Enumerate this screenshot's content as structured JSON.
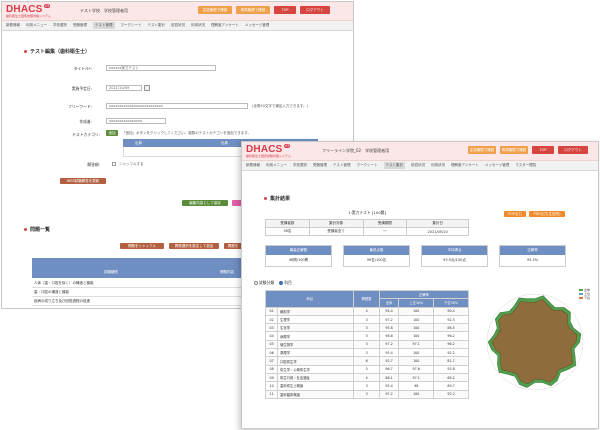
{
  "app": {
    "logo": "DHACS",
    "logo_badge": "V3",
    "logo_tagline": "歯科衛生士国家試験対策システム"
  },
  "colors": {
    "accent": "#d93a4a",
    "header_bg": "#fbe7e7",
    "table_head": "#6f8ec2"
  },
  "back": {
    "school": "テスト学校　学校管理者用",
    "header_buttons": [
      "生徒権限で確認",
      "教員権限で確認",
      "TOP",
      "ログアウト"
    ],
    "nav": [
      "新着情報",
      "利用メニュー",
      "学校選択",
      "受験管理",
      "テスト管理",
      "マークシート",
      "テスト集計",
      "前週状況",
      "利用状況",
      "理解度アンケート",
      "メッセージ管理",
      "マスター閲覧"
    ],
    "nav_active": 4,
    "section_title": "テスト編集（歯科衛生士）",
    "form": {
      "title_label": "タイトル*:",
      "title_value": "xxxxxx実力テスト",
      "date_label": "実施予定日:",
      "date_value": "2021/10/09",
      "freeword_label": "フリーワード:",
      "freeword_value": "xxxxxxxxxxxxxxxxxxxxxxxxxx",
      "freeword_note": "(全角50文字で補足入力できます。)",
      "author_label": "作成者:",
      "author_value": "xxxxxxxxxxxxxxxx",
      "category_label": "テストカテゴリ:",
      "category_add": "追加",
      "category_note": "「追加」ボタンをクリックしてください。複数のテストカテゴリを追加できます。",
      "cat_col1": "出典",
      "cat_col2": "出典",
      "shuffle_label": "解答順:",
      "shuffle_option": "シャッフルする",
      "convert_button": "WEB試験解答を更新",
      "save_button": "編集内容として保存",
      "pink_button": ""
    },
    "q_list_title": "問題一覧",
    "q_buttons": [
      "問題をシャッフル",
      "問題選択を推定して追加",
      "問題を"
    ],
    "q_head_col1": "試験種別",
    "q_head_col2": "問題内容",
    "q_rows": [
      "人体（歯・口腔を除く）の構造と機能",
      "歯・口腔の構造と機能",
      "疾病の成り立ち及び回復過程の促進"
    ]
  },
  "front": {
    "school": "フリーライン学院_02　学校管理者用",
    "header_buttons": [
      "生徒権限で確認",
      "教員権限で確認",
      "TOP",
      "ログアウト"
    ],
    "nav": [
      "新着情報",
      "利用メニュー",
      "学校選択",
      "受験管理",
      "テスト管理",
      "マークシート",
      "テスト集計",
      "前週状況",
      "利用状況",
      "理解度アンケート",
      "メッセージ管理",
      "マスター閲覧"
    ],
    "nav_active": 6,
    "section_title": "集計結果",
    "test_name": "1:実力テスト [100題]",
    "info_headers": [
      "受講者数",
      "集計対象",
      "受講期間",
      "集計日"
    ],
    "info_values": [
      "36名",
      "受講者全て",
      "〜",
      "2021/05/10"
    ],
    "pdf_buttons": [
      "PDF出力",
      "PDF出力(生徒別)"
    ],
    "stats": [
      {
        "label": "最高正解数",
        "value": "98問/100問"
      },
      {
        "label": "最低点数",
        "value": "99名/100名"
      },
      {
        "label": "平均得点",
        "value": "93.5点/100点"
      },
      {
        "label": "正解率",
        "value": "93.5%"
      }
    ],
    "mode_options": [
      "試験分類",
      "科目"
    ],
    "result_headers": [
      "科目",
      "問題数",
      "全体",
      "上位30%",
      "下位30%"
    ],
    "result_group_header": "正解率",
    "result_rows": [
      [
        "01",
        "解剖学",
        "4",
        "94.4",
        "100",
        "90.4"
      ],
      [
        "02",
        "生理学",
        "3",
        "97.2",
        "100",
        "92.5"
      ],
      [
        "03",
        "生化学",
        "3",
        "95.8",
        "100",
        "88.5"
      ],
      [
        "04",
        "病理学",
        "3",
        "98.6",
        "100",
        "96.2"
      ],
      [
        "05",
        "微生物学",
        "3",
        "97.2",
        "97.1",
        "96.2"
      ],
      [
        "06",
        "薬理学",
        "3",
        "95.4",
        "100",
        "92.2"
      ],
      [
        "07",
        "口腔衛生学",
        "6",
        "92.7",
        "100",
        "81.7"
      ],
      [
        "08",
        "衛生学・公衆衛生学",
        "5",
        "96.7",
        "97.6",
        "93.8"
      ],
      [
        "09",
        "衛生行政・社会福祉",
        "4",
        "86.1",
        "97.1",
        "69.2"
      ],
      [
        "10",
        "歯科衛生士概論",
        "3",
        "95.4",
        "98",
        "89.7"
      ],
      [
        "11",
        "歯科臨床概論",
        "3",
        "97.2",
        "100",
        "92.2"
      ]
    ],
    "legend": [
      "全体",
      "上位",
      "下位"
    ]
  }
}
